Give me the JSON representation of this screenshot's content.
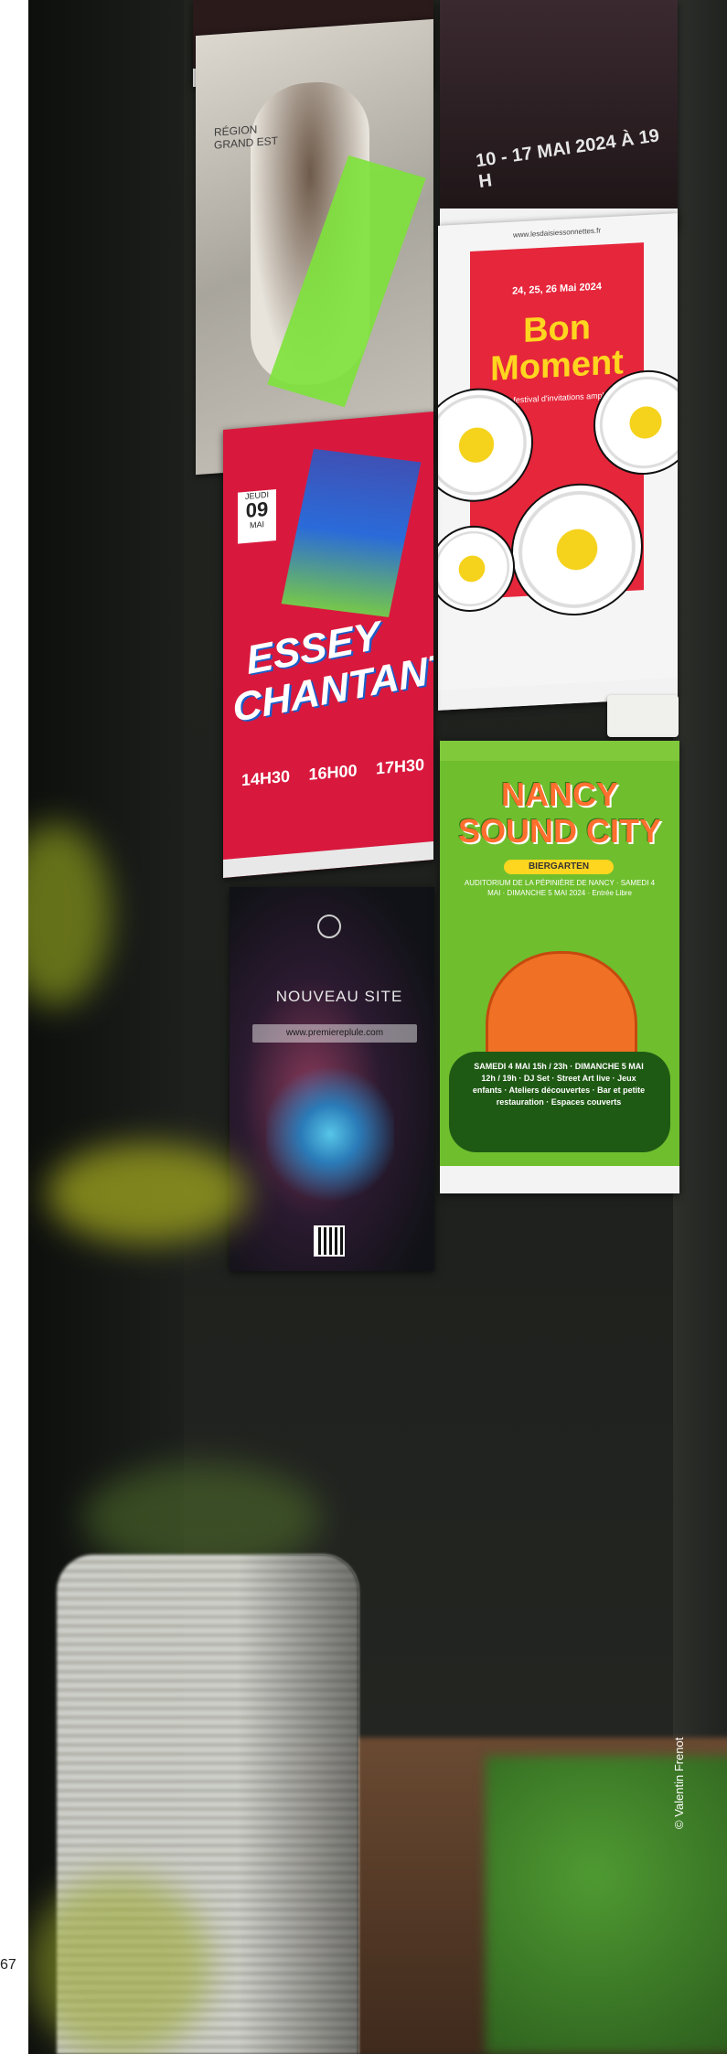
{
  "page_number": "67",
  "photo_credit": "© Valentin Frenot",
  "posters": {
    "dance": {
      "text": "RÉGION GRAND EST"
    },
    "concert": {
      "date": "10 - 17 MAI 2024 À 19 H"
    },
    "bon_moment": {
      "url": "www.lesdaisiessonnettes.fr",
      "dates": "24, 25, 26 Mai 2024",
      "title_line1": "Bon",
      "title_line2": "Moment",
      "subtitle": "Micro-festival d'invitations amplifiées"
    },
    "essey": {
      "day_label": "JEUDI",
      "day_number": "09",
      "month": "MAI",
      "title_line1": "ESSEY",
      "title_line2": "CHANTANT",
      "times": [
        "14H30",
        "16H00",
        "17H30"
      ]
    },
    "nouveau_site": {
      "headline": "NOUVEAU SITE",
      "url": "www.premiereplule.com"
    },
    "nancy": {
      "title_line1": "NANCY",
      "title_line2": "SOUND CITY",
      "venue_badge": "BIERGARTEN",
      "info": "AUDITORIUM DE LA PÉPINIÈRE DE NANCY · SAMEDI 4 MAI · DIMANCHE 5 MAI 2024 · Entrée Libre",
      "program": "SAMEDI 4 MAI 15h / 23h · DIMANCHE 5 MAI 12h / 19h · DJ Set · Street Art live · Jeux enfants · Ateliers découvertes · Bar et petite restauration · Espaces couverts"
    }
  },
  "colors": {
    "wall": "#1e201d",
    "bon_red": "#e6263b",
    "bon_yellow": "#ffd61f",
    "essey_red": "#d8193d",
    "nancy_green": "#6fbe2e",
    "nancy_orange": "#ff6f2e"
  }
}
